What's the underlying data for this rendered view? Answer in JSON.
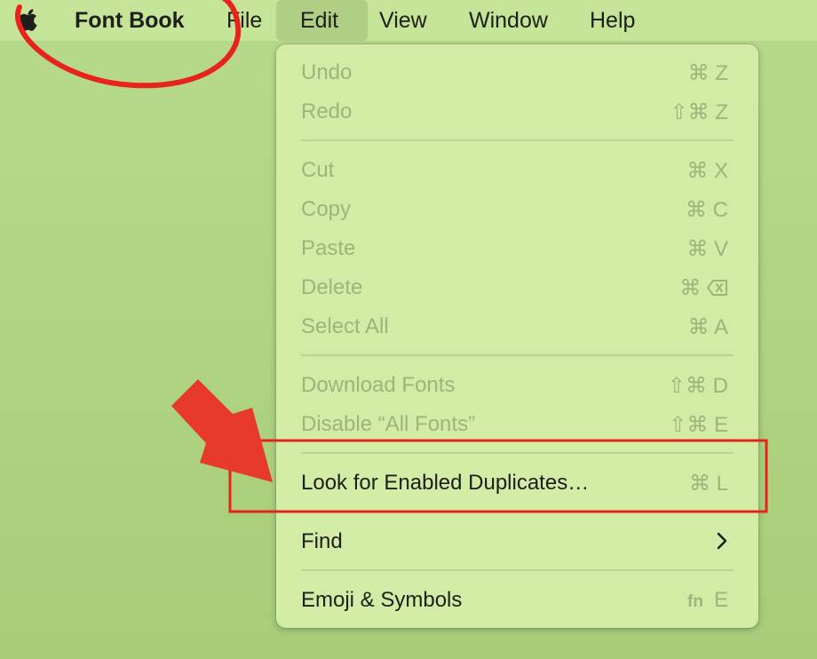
{
  "menubar": {
    "app_name": "Font Book",
    "menus": [
      "File",
      "Edit",
      "View",
      "Window",
      "Help"
    ],
    "active_menu": "Edit"
  },
  "edit_menu": {
    "undo": {
      "label": "Undo",
      "shortcut": "⌘ Z",
      "enabled": false
    },
    "redo": {
      "label": "Redo",
      "shortcut": "⇧⌘ Z",
      "enabled": false
    },
    "cut": {
      "label": "Cut",
      "shortcut": "⌘ X",
      "enabled": false
    },
    "copy": {
      "label": "Copy",
      "shortcut": "⌘ C",
      "enabled": false
    },
    "paste": {
      "label": "Paste",
      "shortcut": "⌘ V",
      "enabled": false
    },
    "delete": {
      "label": "Delete",
      "shortcut": "⌘",
      "enabled": false
    },
    "select_all": {
      "label": "Select All",
      "shortcut": "⌘ A",
      "enabled": false
    },
    "download_fonts": {
      "label": "Download Fonts",
      "shortcut": "⇧⌘ D",
      "enabled": false
    },
    "disable_all_fonts": {
      "label": "Disable “All Fonts”",
      "shortcut": "⇧⌘ E",
      "enabled": false
    },
    "look_for_duplicates": {
      "label": "Look for Enabled Duplicates…",
      "shortcut": "⌘ L",
      "enabled": true
    },
    "find": {
      "label": "Find",
      "enabled": true
    },
    "emoji_symbols": {
      "label": "Emoji & Symbols",
      "shortcut_fn": "fn",
      "shortcut_key": "E",
      "enabled": true
    }
  },
  "annotation_colors": {
    "highlight": "#e8231b",
    "arrow": "#e83a2c"
  }
}
